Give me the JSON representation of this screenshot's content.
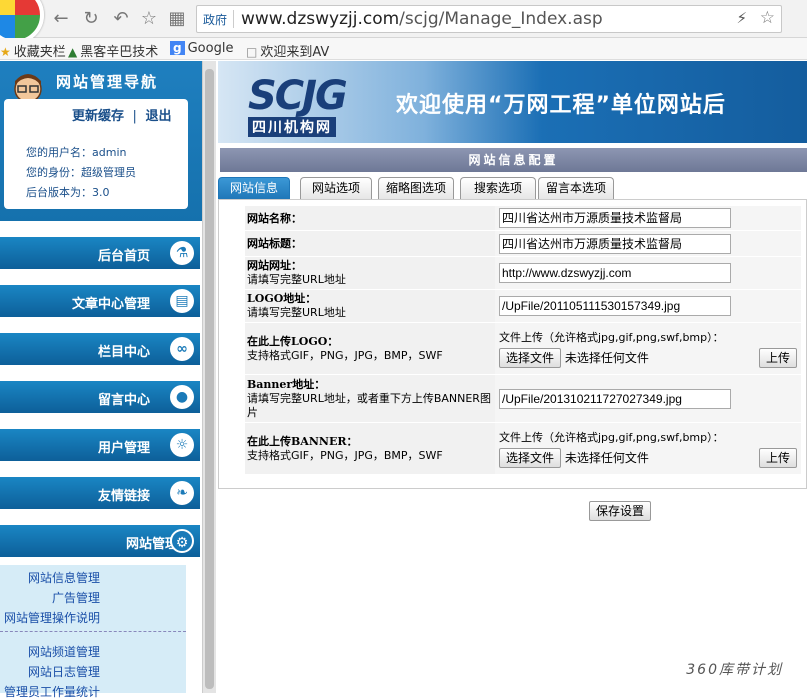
{
  "browser": {
    "addr_tag": "政府",
    "url_host": "www.dzswyzjj.com",
    "url_path": "/scjg/Manage_Index.asp",
    "bookmarks": [
      "收藏夹栏",
      "黑客辛巴技术",
      "Google",
      "欢迎来到AV"
    ]
  },
  "sidebar": {
    "title": "网站管理导航",
    "refresh_label": "更新缓存",
    "divider": "|",
    "logout_label": "退出",
    "username_line": "您的用户名：admin",
    "role_line": "您的身份：超级管理员",
    "version_line": "后台版本为：3.0",
    "menu": [
      {
        "label": "后台首页",
        "icon": "flask-icon"
      },
      {
        "label": "文章中心管理",
        "icon": "book-icon"
      },
      {
        "label": "栏目中心",
        "icon": "link-icon"
      },
      {
        "label": "留言中心",
        "icon": "drop-icon"
      },
      {
        "label": "用户管理",
        "icon": "users-icon"
      },
      {
        "label": "友情链接",
        "icon": "leaf-icon"
      },
      {
        "label": "网站管理",
        "icon": "gear-icon"
      }
    ],
    "sub_links": [
      "网站信息管理",
      "广告管理",
      "网站管理操作说明",
      "网站频道管理",
      "网站日志管理",
      "管理员工作量统计"
    ]
  },
  "banner": {
    "logo_text": "SCJG",
    "logo_sub": "四川机构网",
    "welcome": "欢迎使用“万网工程”单位网站后"
  },
  "main": {
    "section_title": "网站信息配置",
    "tabs": [
      "网站信息",
      "网站选项",
      "缩略图选项",
      "搜索选项",
      "留言本选项"
    ],
    "fields": {
      "site_name_label": "网站名称：",
      "site_name_value": "四川省达州市万源质量技术监督局",
      "site_title_label": "网站标题：",
      "site_title_value": "四川省达州市万源质量技术监督局",
      "site_url_label": "网站网址：",
      "site_url_hint": "请填写完整URL地址",
      "site_url_value": "http://www.dzswyzjj.com",
      "logo_url_label": "LOGO地址：",
      "logo_url_hint": "请填写完整URL地址",
      "logo_url_value": "/UpFile/201105111530157349.jpg",
      "upload_logo_label": "在此上传LOGO：",
      "upload_logo_hint": "支持格式GIF，PNG，JPG，BMP，SWF",
      "upload_note": "文件上传（允许格式jpg,gif,png,swf,bmp）：",
      "choose_file": "选择文件",
      "no_file": "未选择任何文件",
      "upload_btn": "上传",
      "banner_url_label": "Banner地址：",
      "banner_url_hint": "请填写完整URL地址，或者重下方上传BANNER图片",
      "banner_url_value": "/UpFile/201310211727027349.jpg",
      "upload_banner_label": "在此上传BANNER：",
      "upload_banner_hint": "支持格式GIF，PNG，JPG，BMP，SWF"
    },
    "save_label": "保存设置"
  },
  "watermark": "360库带计划"
}
